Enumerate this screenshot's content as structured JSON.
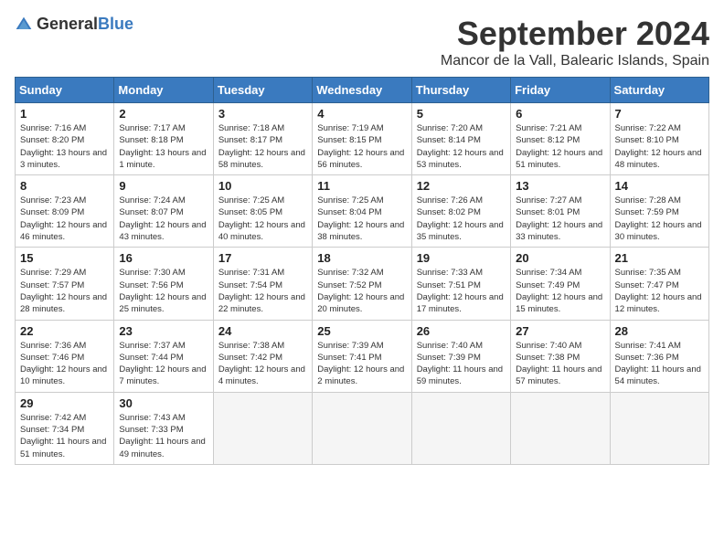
{
  "header": {
    "logo_general": "General",
    "logo_blue": "Blue",
    "month_title": "September 2024",
    "location": "Mancor de la Vall, Balearic Islands, Spain"
  },
  "columns": [
    "Sunday",
    "Monday",
    "Tuesday",
    "Wednesday",
    "Thursday",
    "Friday",
    "Saturday"
  ],
  "weeks": [
    [
      {
        "day": "1",
        "sunrise": "Sunrise: 7:16 AM",
        "sunset": "Sunset: 8:20 PM",
        "daylight": "Daylight: 13 hours and 3 minutes."
      },
      {
        "day": "2",
        "sunrise": "Sunrise: 7:17 AM",
        "sunset": "Sunset: 8:18 PM",
        "daylight": "Daylight: 13 hours and 1 minute."
      },
      {
        "day": "3",
        "sunrise": "Sunrise: 7:18 AM",
        "sunset": "Sunset: 8:17 PM",
        "daylight": "Daylight: 12 hours and 58 minutes."
      },
      {
        "day": "4",
        "sunrise": "Sunrise: 7:19 AM",
        "sunset": "Sunset: 8:15 PM",
        "daylight": "Daylight: 12 hours and 56 minutes."
      },
      {
        "day": "5",
        "sunrise": "Sunrise: 7:20 AM",
        "sunset": "Sunset: 8:14 PM",
        "daylight": "Daylight: 12 hours and 53 minutes."
      },
      {
        "day": "6",
        "sunrise": "Sunrise: 7:21 AM",
        "sunset": "Sunset: 8:12 PM",
        "daylight": "Daylight: 12 hours and 51 minutes."
      },
      {
        "day": "7",
        "sunrise": "Sunrise: 7:22 AM",
        "sunset": "Sunset: 8:10 PM",
        "daylight": "Daylight: 12 hours and 48 minutes."
      }
    ],
    [
      {
        "day": "8",
        "sunrise": "Sunrise: 7:23 AM",
        "sunset": "Sunset: 8:09 PM",
        "daylight": "Daylight: 12 hours and 46 minutes."
      },
      {
        "day": "9",
        "sunrise": "Sunrise: 7:24 AM",
        "sunset": "Sunset: 8:07 PM",
        "daylight": "Daylight: 12 hours and 43 minutes."
      },
      {
        "day": "10",
        "sunrise": "Sunrise: 7:25 AM",
        "sunset": "Sunset: 8:05 PM",
        "daylight": "Daylight: 12 hours and 40 minutes."
      },
      {
        "day": "11",
        "sunrise": "Sunrise: 7:25 AM",
        "sunset": "Sunset: 8:04 PM",
        "daylight": "Daylight: 12 hours and 38 minutes."
      },
      {
        "day": "12",
        "sunrise": "Sunrise: 7:26 AM",
        "sunset": "Sunset: 8:02 PM",
        "daylight": "Daylight: 12 hours and 35 minutes."
      },
      {
        "day": "13",
        "sunrise": "Sunrise: 7:27 AM",
        "sunset": "Sunset: 8:01 PM",
        "daylight": "Daylight: 12 hours and 33 minutes."
      },
      {
        "day": "14",
        "sunrise": "Sunrise: 7:28 AM",
        "sunset": "Sunset: 7:59 PM",
        "daylight": "Daylight: 12 hours and 30 minutes."
      }
    ],
    [
      {
        "day": "15",
        "sunrise": "Sunrise: 7:29 AM",
        "sunset": "Sunset: 7:57 PM",
        "daylight": "Daylight: 12 hours and 28 minutes."
      },
      {
        "day": "16",
        "sunrise": "Sunrise: 7:30 AM",
        "sunset": "Sunset: 7:56 PM",
        "daylight": "Daylight: 12 hours and 25 minutes."
      },
      {
        "day": "17",
        "sunrise": "Sunrise: 7:31 AM",
        "sunset": "Sunset: 7:54 PM",
        "daylight": "Daylight: 12 hours and 22 minutes."
      },
      {
        "day": "18",
        "sunrise": "Sunrise: 7:32 AM",
        "sunset": "Sunset: 7:52 PM",
        "daylight": "Daylight: 12 hours and 20 minutes."
      },
      {
        "day": "19",
        "sunrise": "Sunrise: 7:33 AM",
        "sunset": "Sunset: 7:51 PM",
        "daylight": "Daylight: 12 hours and 17 minutes."
      },
      {
        "day": "20",
        "sunrise": "Sunrise: 7:34 AM",
        "sunset": "Sunset: 7:49 PM",
        "daylight": "Daylight: 12 hours and 15 minutes."
      },
      {
        "day": "21",
        "sunrise": "Sunrise: 7:35 AM",
        "sunset": "Sunset: 7:47 PM",
        "daylight": "Daylight: 12 hours and 12 minutes."
      }
    ],
    [
      {
        "day": "22",
        "sunrise": "Sunrise: 7:36 AM",
        "sunset": "Sunset: 7:46 PM",
        "daylight": "Daylight: 12 hours and 10 minutes."
      },
      {
        "day": "23",
        "sunrise": "Sunrise: 7:37 AM",
        "sunset": "Sunset: 7:44 PM",
        "daylight": "Daylight: 12 hours and 7 minutes."
      },
      {
        "day": "24",
        "sunrise": "Sunrise: 7:38 AM",
        "sunset": "Sunset: 7:42 PM",
        "daylight": "Daylight: 12 hours and 4 minutes."
      },
      {
        "day": "25",
        "sunrise": "Sunrise: 7:39 AM",
        "sunset": "Sunset: 7:41 PM",
        "daylight": "Daylight: 12 hours and 2 minutes."
      },
      {
        "day": "26",
        "sunrise": "Sunrise: 7:40 AM",
        "sunset": "Sunset: 7:39 PM",
        "daylight": "Daylight: 11 hours and 59 minutes."
      },
      {
        "day": "27",
        "sunrise": "Sunrise: 7:40 AM",
        "sunset": "Sunset: 7:38 PM",
        "daylight": "Daylight: 11 hours and 57 minutes."
      },
      {
        "day": "28",
        "sunrise": "Sunrise: 7:41 AM",
        "sunset": "Sunset: 7:36 PM",
        "daylight": "Daylight: 11 hours and 54 minutes."
      }
    ],
    [
      {
        "day": "29",
        "sunrise": "Sunrise: 7:42 AM",
        "sunset": "Sunset: 7:34 PM",
        "daylight": "Daylight: 11 hours and 51 minutes."
      },
      {
        "day": "30",
        "sunrise": "Sunrise: 7:43 AM",
        "sunset": "Sunset: 7:33 PM",
        "daylight": "Daylight: 11 hours and 49 minutes."
      },
      null,
      null,
      null,
      null,
      null
    ]
  ]
}
